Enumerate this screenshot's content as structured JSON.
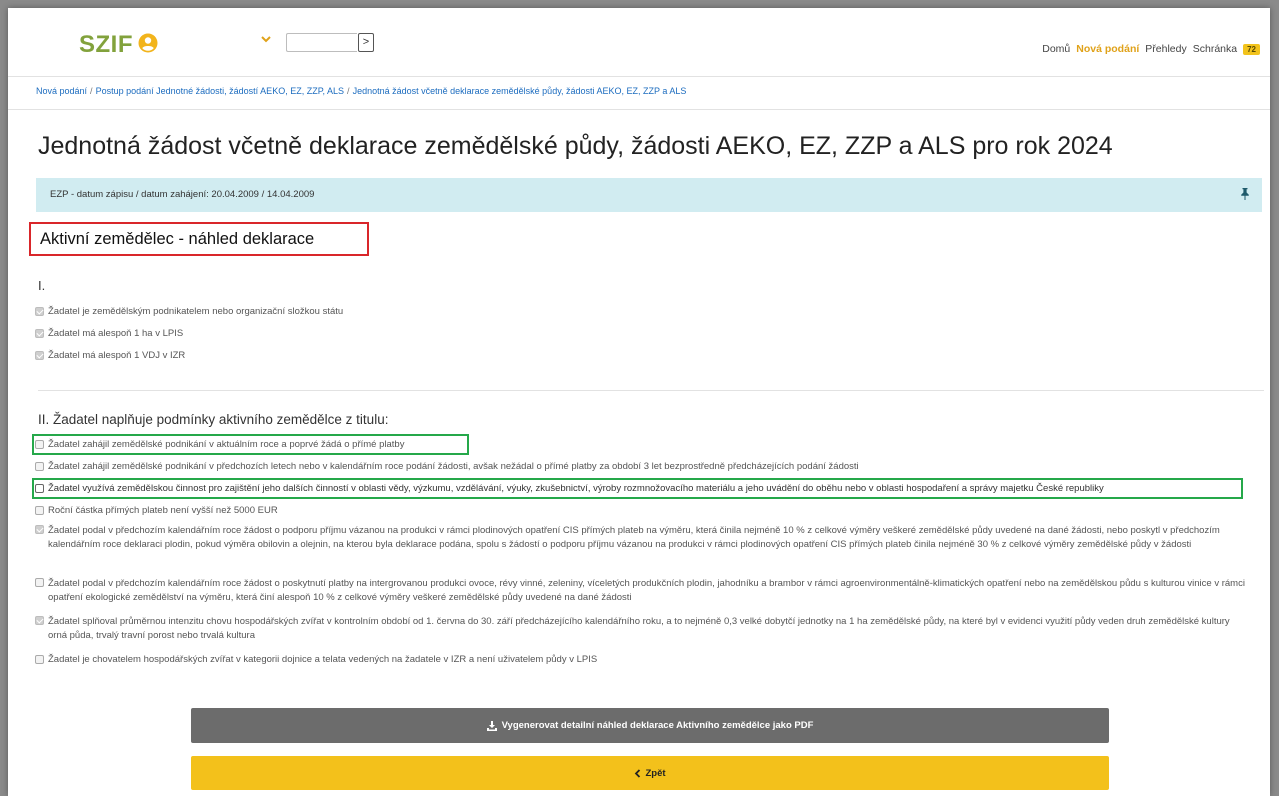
{
  "header": {
    "logo": "SZIF",
    "nav": [
      "Domů",
      "Nová podání",
      "Přehledy",
      "Schránka"
    ],
    "nav_active_index": 1,
    "badge_count": "72",
    "go_button": ">"
  },
  "breadcrumb": [
    "Nová podání",
    "Postup podání Jednotné žádosti, žádostí AEKO, EZ, ZZP, ALS",
    "Jednotná žádost včetně deklarace zemědělské půdy, žádosti AEKO, EZ, ZZP a ALS"
  ],
  "page_title": "Jednotná žádost včetně deklarace zemědělské půdy, žádosti AEKO, EZ, ZZP a ALS pro rok 2024",
  "info_bar": "EZP - datum zápisu / datum zahájení: 20.04.2009 / 14.04.2009",
  "section_title": "Aktivní zemědělec - náhled deklarace",
  "section1": {
    "heading": "I.",
    "items": [
      {
        "label": "Žadatel je zemědělským podnikatelem nebo organizační složkou státu",
        "checked": true
      },
      {
        "label": "Žadatel má alespoň 1 ha v LPIS",
        "checked": true
      },
      {
        "label": "Žadatel má alespoň 1 VDJ v IZR",
        "checked": true
      }
    ]
  },
  "section2": {
    "heading": "II. Žadatel naplňuje podmínky aktivního zemědělce z titulu:",
    "items": [
      {
        "label": "Žadatel zahájil zemědělské podnikání v aktuálním roce a poprvé žádá o přímé platby",
        "checked": false
      },
      {
        "label": "Žadatel zahájil zemědělské podnikání v předchozích letech nebo v kalendářním roce podání žádosti, avšak nežádal o přímé platby za období 3 let bezprostředně předcházejících podání žádosti",
        "checked": false
      },
      {
        "label": "Žadatel využívá zemědělskou činnost pro zajištění jeho dalších činností v oblasti vědy, výzkumu, vzdělávání, výuky, zkušebnictví, výroby rozmnožovacího materiálu a jeho uvádění do oběhu nebo v oblasti hospodaření a správy majetku České republiky",
        "checked": false
      },
      {
        "label": "Roční částka přímých plateb není vyšší než 5000 EUR",
        "checked": false
      },
      {
        "label": "Žadatel podal v předchozím kalendářním roce žádost o podporu příjmu vázanou na produkci v rámci plodinových opatření CIS přímých plateb na výměru, která činila nejméně 10 % z celkové výměry veškeré zemědělské půdy uvedené na dané žádosti, nebo poskytl v předchozím kalendářním roce deklaraci plodin, pokud výměra obilovin a olejnin, na kterou byla deklarace podána, spolu s žádostí o podporu příjmu vázanou na produkci v rámci plodinových opatření CIS přímých plateb činila nejméně 30 % z celkové výměry zemědělské půdy v žádosti",
        "checked": true
      },
      {
        "label": "Žadatel podal v předchozím kalendářním roce žádost o poskytnutí platby na intergrovanou produkci ovoce, révy vinné, zeleniny, víceletých produkčních plodin, jahodníku a brambor v rámci agroenvironmentálně-klimatických opatření nebo na zemědělskou půdu s kulturou vinice v rámci opatření ekologické zemědělství na výměru, která činí alespoň 10 % z celkové výměry veškeré zemědělské půdy uvedené na dané žádosti",
        "checked": false
      },
      {
        "label": "Žadatel splňoval průměrnou intenzitu chovu hospodářských zvířat v kontrolním období od 1. června do 30. září předcházejícího kalendářního roku, a to nejméně 0,3 velké dobytčí jednotky na 1 ha zemědělské půdy, na které byl v evidenci využití půdy veden druh zemědělské kultury orná půda, trvalý travní porost nebo trvalá kultura",
        "checked": true
      },
      {
        "label": "Žadatel je chovatelem hospodářských zvířat v kategorii dojnice a telata vedených na žadatele v IZR a není uživatelem půdy v LPIS",
        "checked": false
      }
    ]
  },
  "buttons": {
    "pdf": "Vygenerovat detailní náhled deklarace Aktivního zemědělce jako PDF",
    "back": "Zpět"
  }
}
